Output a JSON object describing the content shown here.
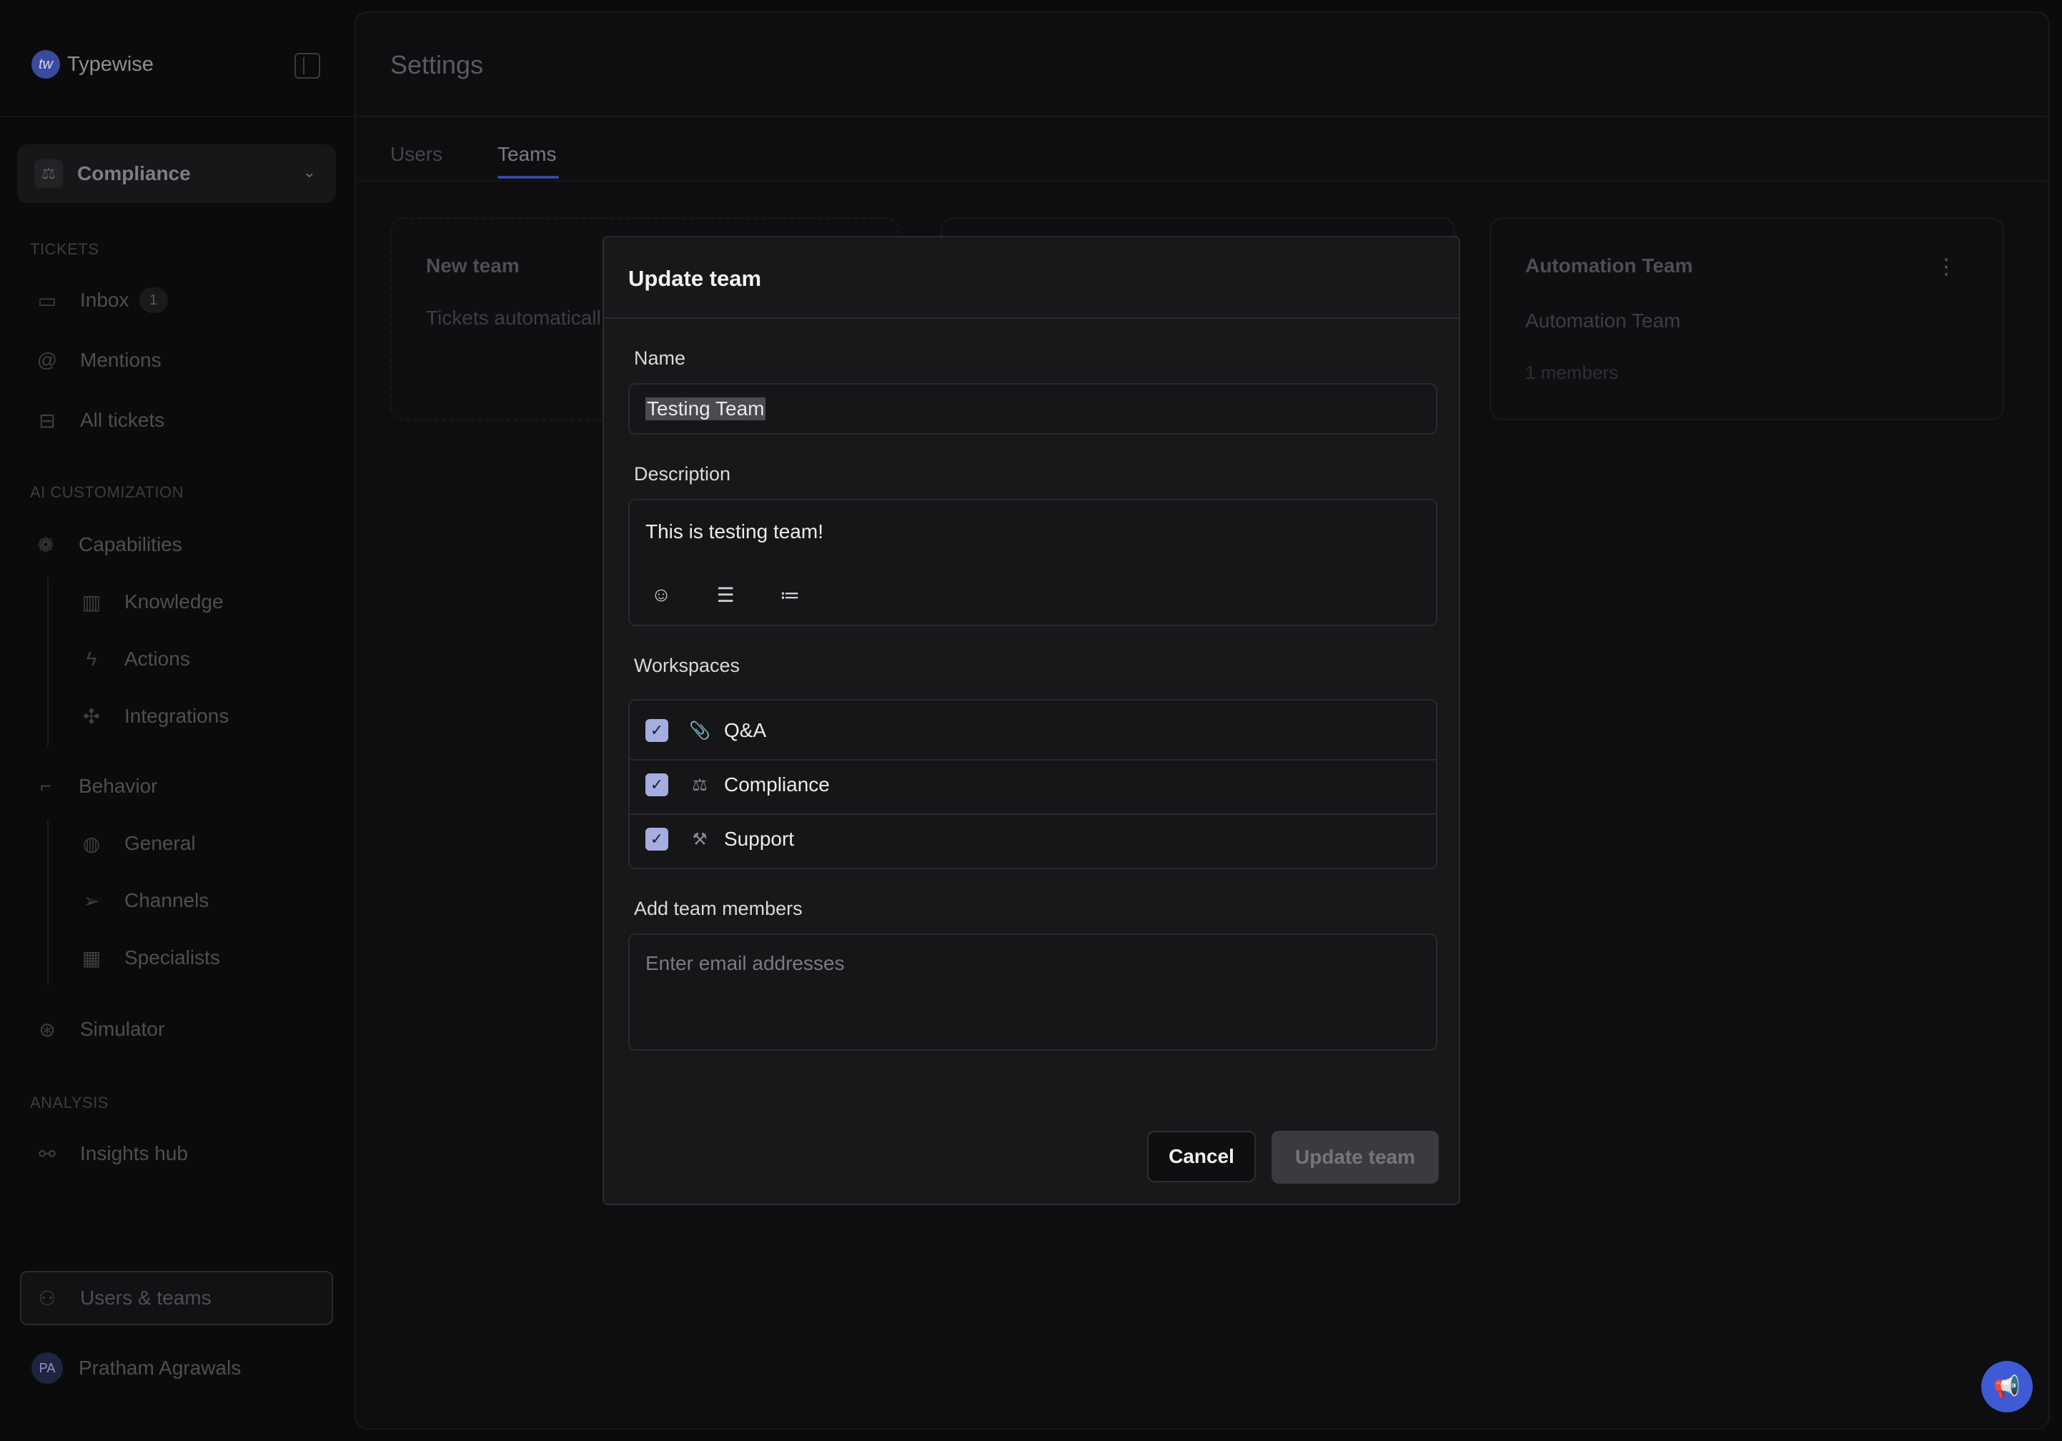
{
  "app": {
    "brand": "Typewise",
    "brand_mark": "tw"
  },
  "sidebar": {
    "workspace": {
      "label": "Compliance",
      "icon": "scale-icon"
    },
    "sections": {
      "tickets": "TICKETS",
      "ai_customization": "AI CUSTOMIZATION",
      "analysis": "ANALYSIS"
    },
    "items": {
      "inbox": {
        "label": "Inbox",
        "badge": "1"
      },
      "mentions": {
        "label": "Mentions"
      },
      "all_tickets": {
        "label": "All tickets"
      },
      "capabilities": {
        "label": "Capabilities"
      },
      "knowledge": {
        "label": "Knowledge"
      },
      "actions": {
        "label": "Actions"
      },
      "integrations": {
        "label": "Integrations"
      },
      "behavior": {
        "label": "Behavior"
      },
      "general": {
        "label": "General"
      },
      "channels": {
        "label": "Channels"
      },
      "specialists": {
        "label": "Specialists"
      },
      "simulator": {
        "label": "Simulator"
      },
      "insights_hub": {
        "label": "Insights hub"
      },
      "users_teams": {
        "label": "Users & teams"
      }
    },
    "user": {
      "name": "Pratham Agrawals",
      "initials": "PA"
    }
  },
  "main": {
    "title": "Settings",
    "tabs": [
      {
        "label": "Users",
        "active": false
      },
      {
        "label": "Teams",
        "active": true
      }
    ],
    "cards": [
      {
        "title": "New team",
        "description": "Tickets automaticall based on their desc"
      },
      {
        "title": "Automation Team",
        "description": "Automation Team",
        "meta": "1 members"
      }
    ]
  },
  "modal": {
    "title": "Update team",
    "name_label": "Name",
    "name_value": "Testing Team",
    "description_label": "Description",
    "description_value": "This is testing team!",
    "toolbar": [
      "emoji-icon",
      "bullet-list-icon",
      "numbered-list-icon"
    ],
    "workspaces_label": "Workspaces",
    "workspaces": [
      {
        "name": "Q&A",
        "checked": true,
        "icon": "paperclip-icon"
      },
      {
        "name": "Compliance",
        "checked": true,
        "icon": "scale-icon"
      },
      {
        "name": "Support",
        "checked": true,
        "icon": "tools-icon"
      }
    ],
    "members_label": "Add team members",
    "members_placeholder": "Enter email addresses",
    "cancel_label": "Cancel",
    "submit_label": "Update team"
  },
  "colors": {
    "accent": "#3847a2",
    "fab": "#3f5bd4",
    "checkbox": "#a5aedf"
  }
}
